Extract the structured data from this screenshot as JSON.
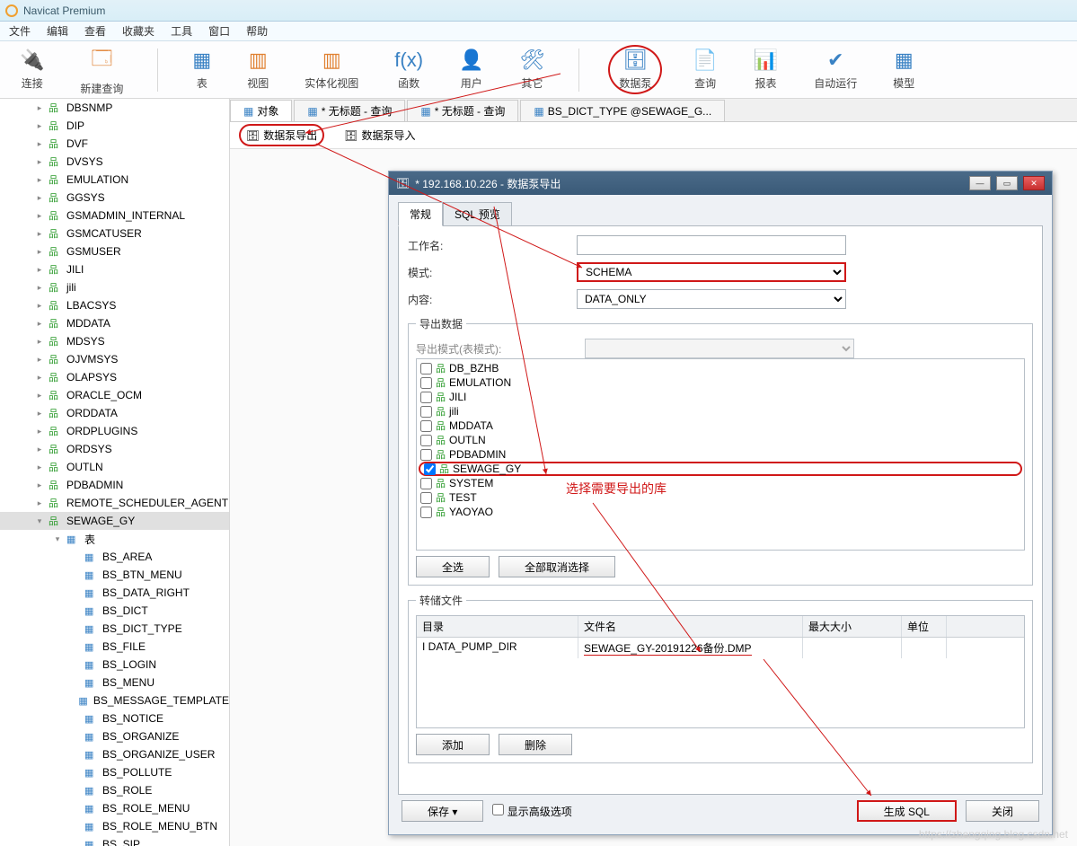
{
  "app": {
    "title": "Navicat Premium"
  },
  "menu": [
    "文件",
    "编辑",
    "查看",
    "收藏夹",
    "工具",
    "窗口",
    "帮助"
  ],
  "toolbar": [
    {
      "label": "连接",
      "glyph": "🔌",
      "cls": ""
    },
    {
      "label": "新建查询",
      "glyph": "🗔",
      "cls": "orange"
    },
    {
      "label": "表",
      "glyph": "▦",
      "cls": ""
    },
    {
      "label": "视图",
      "glyph": "▥",
      "cls": "orange"
    },
    {
      "label": "实体化视图",
      "glyph": "▥",
      "cls": "orange"
    },
    {
      "label": "函数",
      "glyph": "f(x)",
      "cls": ""
    },
    {
      "label": "用户",
      "glyph": "👤",
      "cls": "orange"
    },
    {
      "label": "其它",
      "glyph": "🛠",
      "cls": ""
    },
    {
      "label": "数据泵",
      "glyph": "🗄",
      "cls": "",
      "hl": true
    },
    {
      "label": "查询",
      "glyph": "📄",
      "cls": ""
    },
    {
      "label": "报表",
      "glyph": "📊",
      "cls": ""
    },
    {
      "label": "自动运行",
      "glyph": "✔",
      "cls": ""
    },
    {
      "label": "模型",
      "glyph": "▦",
      "cls": ""
    }
  ],
  "tree": [
    {
      "t": "DBSNMP",
      "k": "schema"
    },
    {
      "t": "DIP",
      "k": "schema"
    },
    {
      "t": "DVF",
      "k": "schema"
    },
    {
      "t": "DVSYS",
      "k": "schema"
    },
    {
      "t": "EMULATION",
      "k": "schema"
    },
    {
      "t": "GGSYS",
      "k": "schema"
    },
    {
      "t": "GSMADMIN_INTERNAL",
      "k": "schema"
    },
    {
      "t": "GSMCATUSER",
      "k": "schema"
    },
    {
      "t": "GSMUSER",
      "k": "schema"
    },
    {
      "t": "JILI",
      "k": "schema"
    },
    {
      "t": "jili",
      "k": "schema"
    },
    {
      "t": "LBACSYS",
      "k": "schema"
    },
    {
      "t": "MDDATA",
      "k": "schema"
    },
    {
      "t": "MDSYS",
      "k": "schema"
    },
    {
      "t": "OJVMSYS",
      "k": "schema"
    },
    {
      "t": "OLAPSYS",
      "k": "schema"
    },
    {
      "t": "ORACLE_OCM",
      "k": "schema"
    },
    {
      "t": "ORDDATA",
      "k": "schema"
    },
    {
      "t": "ORDPLUGINS",
      "k": "schema"
    },
    {
      "t": "ORDSYS",
      "k": "schema"
    },
    {
      "t": "OUTLN",
      "k": "schema"
    },
    {
      "t": "PDBADMIN",
      "k": "schema"
    },
    {
      "t": "REMOTE_SCHEDULER_AGENT",
      "k": "schema"
    },
    {
      "t": "SEWAGE_GY",
      "k": "schema",
      "exp": true,
      "sel": true
    },
    {
      "t": "表",
      "k": "folder",
      "lvl": 2,
      "exp": true
    },
    {
      "t": "BS_AREA",
      "k": "table",
      "lvl": 3
    },
    {
      "t": "BS_BTN_MENU",
      "k": "table",
      "lvl": 3
    },
    {
      "t": "BS_DATA_RIGHT",
      "k": "table",
      "lvl": 3
    },
    {
      "t": "BS_DICT",
      "k": "table",
      "lvl": 3
    },
    {
      "t": "BS_DICT_TYPE",
      "k": "table",
      "lvl": 3
    },
    {
      "t": "BS_FILE",
      "k": "table",
      "lvl": 3
    },
    {
      "t": "BS_LOGIN",
      "k": "table",
      "lvl": 3
    },
    {
      "t": "BS_MENU",
      "k": "table",
      "lvl": 3
    },
    {
      "t": "BS_MESSAGE_TEMPLATE",
      "k": "table",
      "lvl": 3
    },
    {
      "t": "BS_NOTICE",
      "k": "table",
      "lvl": 3
    },
    {
      "t": "BS_ORGANIZE",
      "k": "table",
      "lvl": 3
    },
    {
      "t": "BS_ORGANIZE_USER",
      "k": "table",
      "lvl": 3
    },
    {
      "t": "BS_POLLUTE",
      "k": "table",
      "lvl": 3
    },
    {
      "t": "BS_ROLE",
      "k": "table",
      "lvl": 3
    },
    {
      "t": "BS_ROLE_MENU",
      "k": "table",
      "lvl": 3
    },
    {
      "t": "BS_ROLE_MENU_BTN",
      "k": "table",
      "lvl": 3
    },
    {
      "t": "BS_SIP",
      "k": "table",
      "lvl": 3
    }
  ],
  "tabs": {
    "items": [
      {
        "label": "对象",
        "active": true
      },
      {
        "label": "* 无标题 - 查询"
      },
      {
        "label": "* 无标题 - 查询"
      },
      {
        "label": "BS_DICT_TYPE @SEWAGE_G..."
      }
    ]
  },
  "subbar": {
    "export": "数据泵导出",
    "import": "数据泵导入"
  },
  "dialog": {
    "title": "* 192.168.10.226 - 数据泵导出",
    "tabs": {
      "general": "常规",
      "sql": "SQL 预览"
    },
    "labels": {
      "job": "工作名:",
      "mode": "模式:",
      "content": "内容:",
      "export_group": "导出数据",
      "export_mode": "导出模式(表模式):",
      "select_all": "全选",
      "deselect_all": "全部取消选择",
      "dump_group": "转储文件",
      "col_dir": "目录",
      "col_file": "文件名",
      "col_size": "最大大小",
      "col_unit": "单位",
      "add": "添加",
      "delete": "删除",
      "save": "保存",
      "advanced": "显示高级选项",
      "gen_sql": "生成 SQL",
      "close": "关闭"
    },
    "values": {
      "job": "",
      "mode": "SCHEMA",
      "content": "DATA_ONLY"
    },
    "schemas": [
      {
        "name": "DB_BZHB"
      },
      {
        "name": "EMULATION"
      },
      {
        "name": "JILI"
      },
      {
        "name": "jili"
      },
      {
        "name": "MDDATA"
      },
      {
        "name": "OUTLN"
      },
      {
        "name": "PDBADMIN"
      },
      {
        "name": "SEWAGE_GY",
        "checked": true,
        "hl": true
      },
      {
        "name": "SYSTEM"
      },
      {
        "name": "TEST"
      },
      {
        "name": "YAOYAO"
      }
    ],
    "dump": {
      "dir": "DATA_PUMP_DIR",
      "file": "SEWAGE_GY-20191226备份.DMP",
      "size": "",
      "unit": ""
    }
  },
  "annotations": {
    "select_db": "选择需要导出的库"
  },
  "watermark": "https://zhengqing.blog.csdn.net"
}
